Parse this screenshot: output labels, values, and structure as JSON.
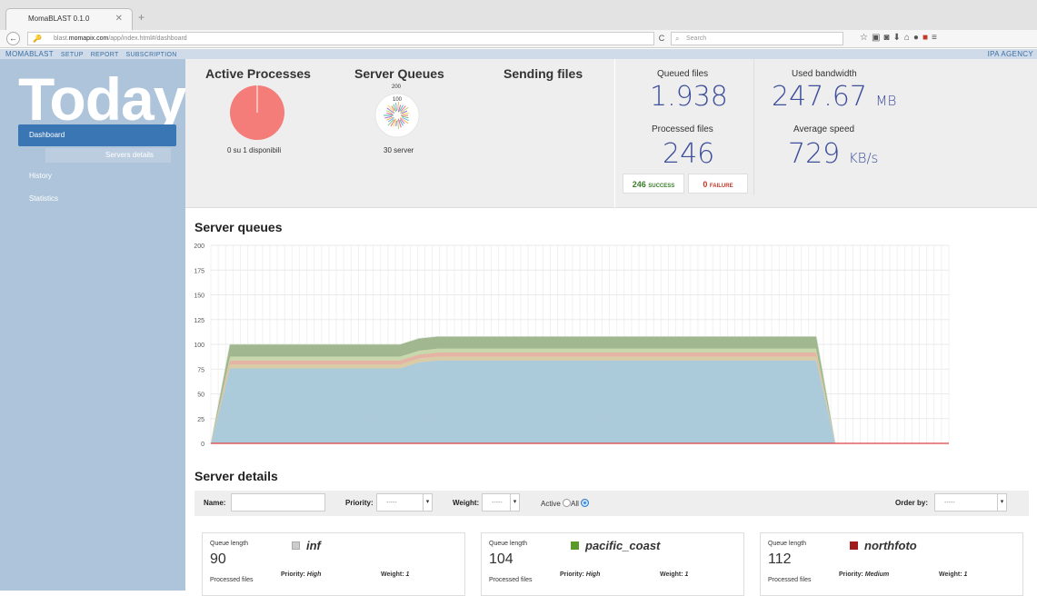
{
  "browser": {
    "tab_title": "MomaBLAST 0.1.0",
    "url_prefix": "blast.",
    "url_domain": "momapix.com",
    "url_path": "/app/index.html#/dashboard",
    "search_placeholder": "Search"
  },
  "menubar": {
    "brand": "MomaBLAST",
    "items": [
      "SETUP",
      "REPORT",
      "SUBSCRIPTION"
    ],
    "agency": "IPA AGENCY"
  },
  "sidebar": {
    "heading": "Today",
    "items": [
      {
        "label": "Dashboard",
        "active": true
      },
      {
        "label": "Servers details",
        "sub": true
      },
      {
        "label": "History"
      },
      {
        "label": "Statistics"
      }
    ]
  },
  "stats": {
    "active_processes": {
      "title": "Active Processes",
      "caption": "0 su 1 disponibili",
      "fraction": 1.0
    },
    "server_queues": {
      "title": "Server Queues",
      "caption": "30 server",
      "scale_top": "200",
      "scale_mid": "100"
    },
    "sending_files": {
      "title": "Sending files"
    },
    "queued_files": {
      "label": "Queued files",
      "value": "1.938"
    },
    "processed_files": {
      "label": "Processed files",
      "value": "246"
    },
    "used_bandwidth": {
      "label": "Used bandwidth",
      "value": "247.67",
      "unit": "MB"
    },
    "average_speed": {
      "label": "Average speed",
      "value": "729",
      "unit": "KB/s"
    },
    "success": {
      "count": "246",
      "label": "SUCCESS"
    },
    "failure": {
      "count": "0",
      "label": "FAILURE"
    }
  },
  "chart_section_title": "Server queues",
  "chart_data": {
    "type": "area",
    "title": "",
    "xlabel": "",
    "ylabel": "",
    "ylim": [
      0,
      200
    ],
    "yticks": [
      0,
      25,
      50,
      75,
      100,
      125,
      150,
      175,
      200
    ],
    "grid": true,
    "x": [
      0,
      1,
      2,
      3,
      4,
      5,
      6,
      7,
      8,
      9,
      10,
      11,
      12,
      13,
      14,
      15,
      16,
      17,
      18,
      19,
      20,
      21,
      22,
      23,
      24,
      25,
      26,
      27,
      28,
      29,
      30,
      31,
      32,
      33,
      34,
      35,
      36,
      37,
      38,
      39
    ],
    "series": [
      {
        "color": "#a8c8d8",
        "values": [
          0,
          76,
          76,
          76,
          76,
          76,
          76,
          76,
          76,
          76,
          76,
          82,
          84,
          84,
          84,
          84,
          84,
          84,
          84,
          84,
          84,
          84,
          84,
          84,
          84,
          84,
          84,
          84,
          84,
          84,
          84,
          84,
          84,
          0,
          0,
          0,
          0,
          0,
          0,
          0
        ]
      },
      {
        "color": "#d9c9a3",
        "values": [
          0,
          4,
          4,
          4,
          4,
          4,
          4,
          4,
          4,
          4,
          4,
          4,
          4,
          4,
          4,
          4,
          4,
          4,
          4,
          4,
          4,
          4,
          4,
          4,
          4,
          4,
          4,
          4,
          4,
          4,
          4,
          4,
          4,
          0,
          0,
          0,
          0,
          0,
          0,
          0
        ]
      },
      {
        "color": "#e3b0a0",
        "values": [
          0,
          4,
          4,
          4,
          4,
          4,
          4,
          4,
          4,
          4,
          4,
          4,
          4,
          4,
          4,
          4,
          4,
          4,
          4,
          4,
          4,
          4,
          4,
          4,
          4,
          4,
          4,
          4,
          4,
          4,
          4,
          4,
          4,
          0,
          0,
          0,
          0,
          0,
          0,
          0
        ]
      },
      {
        "color": "#c5d6a8",
        "values": [
          0,
          4,
          4,
          4,
          4,
          4,
          4,
          4,
          4,
          4,
          4,
          4,
          4,
          4,
          4,
          4,
          4,
          4,
          4,
          4,
          4,
          4,
          4,
          4,
          4,
          4,
          4,
          4,
          4,
          4,
          4,
          4,
          4,
          0,
          0,
          0,
          0,
          0,
          0,
          0
        ]
      },
      {
        "color": "#9bb38a",
        "values": [
          0,
          12,
          12,
          12,
          12,
          12,
          12,
          12,
          12,
          12,
          12,
          12,
          12,
          12,
          12,
          12,
          12,
          12,
          12,
          12,
          12,
          12,
          12,
          12,
          12,
          12,
          12,
          12,
          12,
          12,
          12,
          12,
          12,
          0,
          0,
          0,
          0,
          0,
          0,
          0
        ]
      }
    ],
    "zero_line_color": "#e04040"
  },
  "details": {
    "title": "Server details",
    "filters": {
      "name_label": "Name:",
      "priority_label": "Priority:",
      "priority_value": "-----",
      "weight_label": "Weight:",
      "weight_value": "-----",
      "active_label": "Active",
      "all_label": "All",
      "order_label": "Order by:",
      "order_value": "-----"
    },
    "cards": [
      {
        "queue_label": "Queue length",
        "queue_value": "90",
        "processed_label": "Processed files",
        "name": "inf",
        "color": "#cccccc",
        "priority_label": "Priority:",
        "priority": "High",
        "weight_label": "Weight:",
        "weight": "1"
      },
      {
        "queue_label": "Queue length",
        "queue_value": "104",
        "processed_label": "Processed files",
        "name": "pacific_coast",
        "color": "#5a9a2a",
        "priority_label": "Priority:",
        "priority": "High",
        "weight_label": "Weight:",
        "weight": "1"
      },
      {
        "queue_label": "Queue length",
        "queue_value": "112",
        "processed_label": "Processed files",
        "name": "northfoto",
        "color": "#a01c1c",
        "priority_label": "Priority:",
        "priority": "Medium",
        "weight_label": "Weight:",
        "weight": "1"
      }
    ]
  }
}
